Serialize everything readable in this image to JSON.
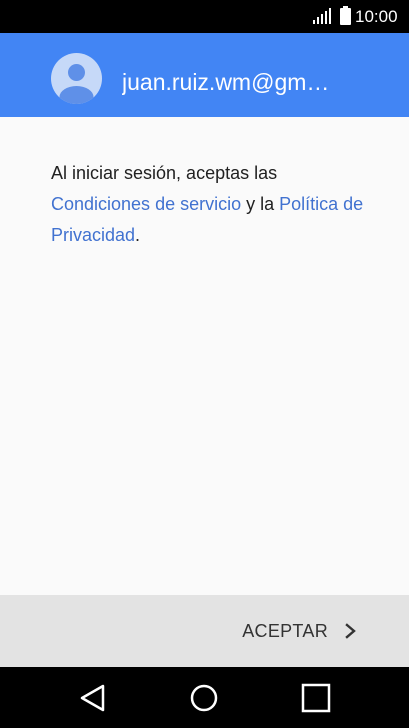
{
  "status_bar": {
    "time": "10:00",
    "icons": [
      "signal-icon",
      "battery-icon"
    ]
  },
  "account": {
    "email": "juan.ruiz.wm@gm…",
    "avatar_icon": "account-avatar-icon"
  },
  "consent": {
    "text_before": "Al iniciar sesión, aceptas las ",
    "terms_link": "Condiciones de servicio",
    "text_middle": " y la ",
    "privacy_link": "Política de Privacidad",
    "text_end": "."
  },
  "actions": {
    "accept_label": "ACEPTAR",
    "accept_icon": "chevron-right-icon"
  },
  "nav_bar": {
    "icons": [
      "back-icon",
      "home-icon",
      "recents-icon"
    ]
  },
  "colors": {
    "header": "#4285f4",
    "link": "#4172d0",
    "action_bar": "#e3e3e3",
    "background": "#fafafa"
  }
}
